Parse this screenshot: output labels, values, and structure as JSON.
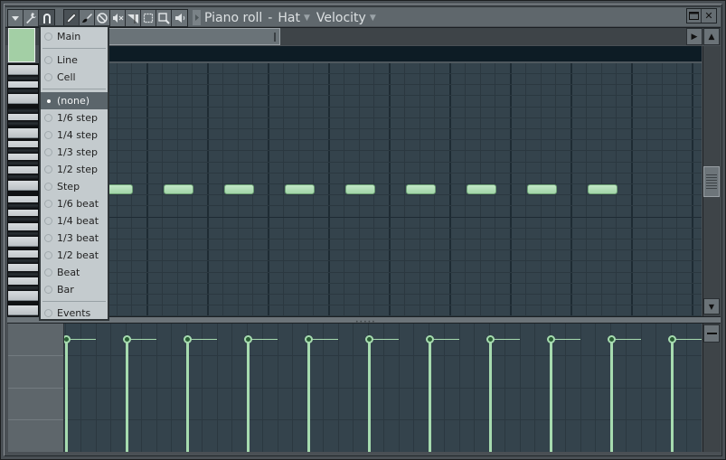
{
  "window": {
    "title_parts": {
      "app": "Piano roll",
      "separator": "-",
      "channel": "Hat",
      "event_target": "Velocity"
    },
    "controls": {
      "maximize_icon": "maximize-icon",
      "close_icon": "close-icon",
      "close_glyph": "✕"
    }
  },
  "toolbar": {
    "left_group": [
      {
        "name": "options-menu-button",
        "icon": "triangle-down-icon",
        "glyph": "▾"
      },
      {
        "name": "tools-button",
        "icon": "wrench-icon",
        "glyph": ""
      },
      {
        "name": "snap-button",
        "icon": "magnet-icon",
        "glyph": "∩",
        "active": true
      }
    ],
    "tools_group": [
      {
        "name": "draw-tool-button",
        "icon": "pencil-icon",
        "active": true
      },
      {
        "name": "paint-tool-button",
        "icon": "brush-icon"
      },
      {
        "name": "delete-tool-button",
        "icon": "delete-icon"
      },
      {
        "name": "mute-tool-button",
        "icon": "mute-icon"
      },
      {
        "name": "slice-tool-button",
        "icon": "slice-icon"
      },
      {
        "name": "select-tool-button",
        "icon": "select-icon"
      },
      {
        "name": "zoom-tool-button",
        "icon": "zoom-icon"
      },
      {
        "name": "playback-tool-button",
        "icon": "speaker-icon"
      }
    ]
  },
  "colors": {
    "note_fill": "#a9d9af",
    "grid_bg": "#34434c",
    "timeline_bg": "#0d1c25",
    "menu_bg": "#c4cbce",
    "menu_selected_bg": "#5b656b",
    "event_color": "#a6dbaf"
  },
  "snap_menu": {
    "items": [
      {
        "label": "Main",
        "selected": false
      },
      {
        "separator": true
      },
      {
        "label": "Line",
        "selected": false
      },
      {
        "label": "Cell",
        "selected": false
      },
      {
        "separator": true
      },
      {
        "label": "(none)",
        "selected": true
      },
      {
        "label": "1/6 step",
        "selected": false
      },
      {
        "label": "1/4 step",
        "selected": false
      },
      {
        "label": "1/3 step",
        "selected": false
      },
      {
        "label": "1/2 step",
        "selected": false
      },
      {
        "label": "Step",
        "selected": false
      },
      {
        "label": "1/6 beat",
        "selected": false
      },
      {
        "label": "1/4 beat",
        "selected": false
      },
      {
        "label": "1/3 beat",
        "selected": false
      },
      {
        "label": "1/2 beat",
        "selected": false
      },
      {
        "label": "Beat",
        "selected": false
      },
      {
        "label": "Bar",
        "selected": false
      },
      {
        "separator": true
      },
      {
        "label": "Events",
        "selected": false
      }
    ]
  },
  "notes": {
    "count": 10,
    "step_interval": 4,
    "length_steps": 1
  },
  "events": {
    "count": 11,
    "velocity_fraction": 0.88
  }
}
